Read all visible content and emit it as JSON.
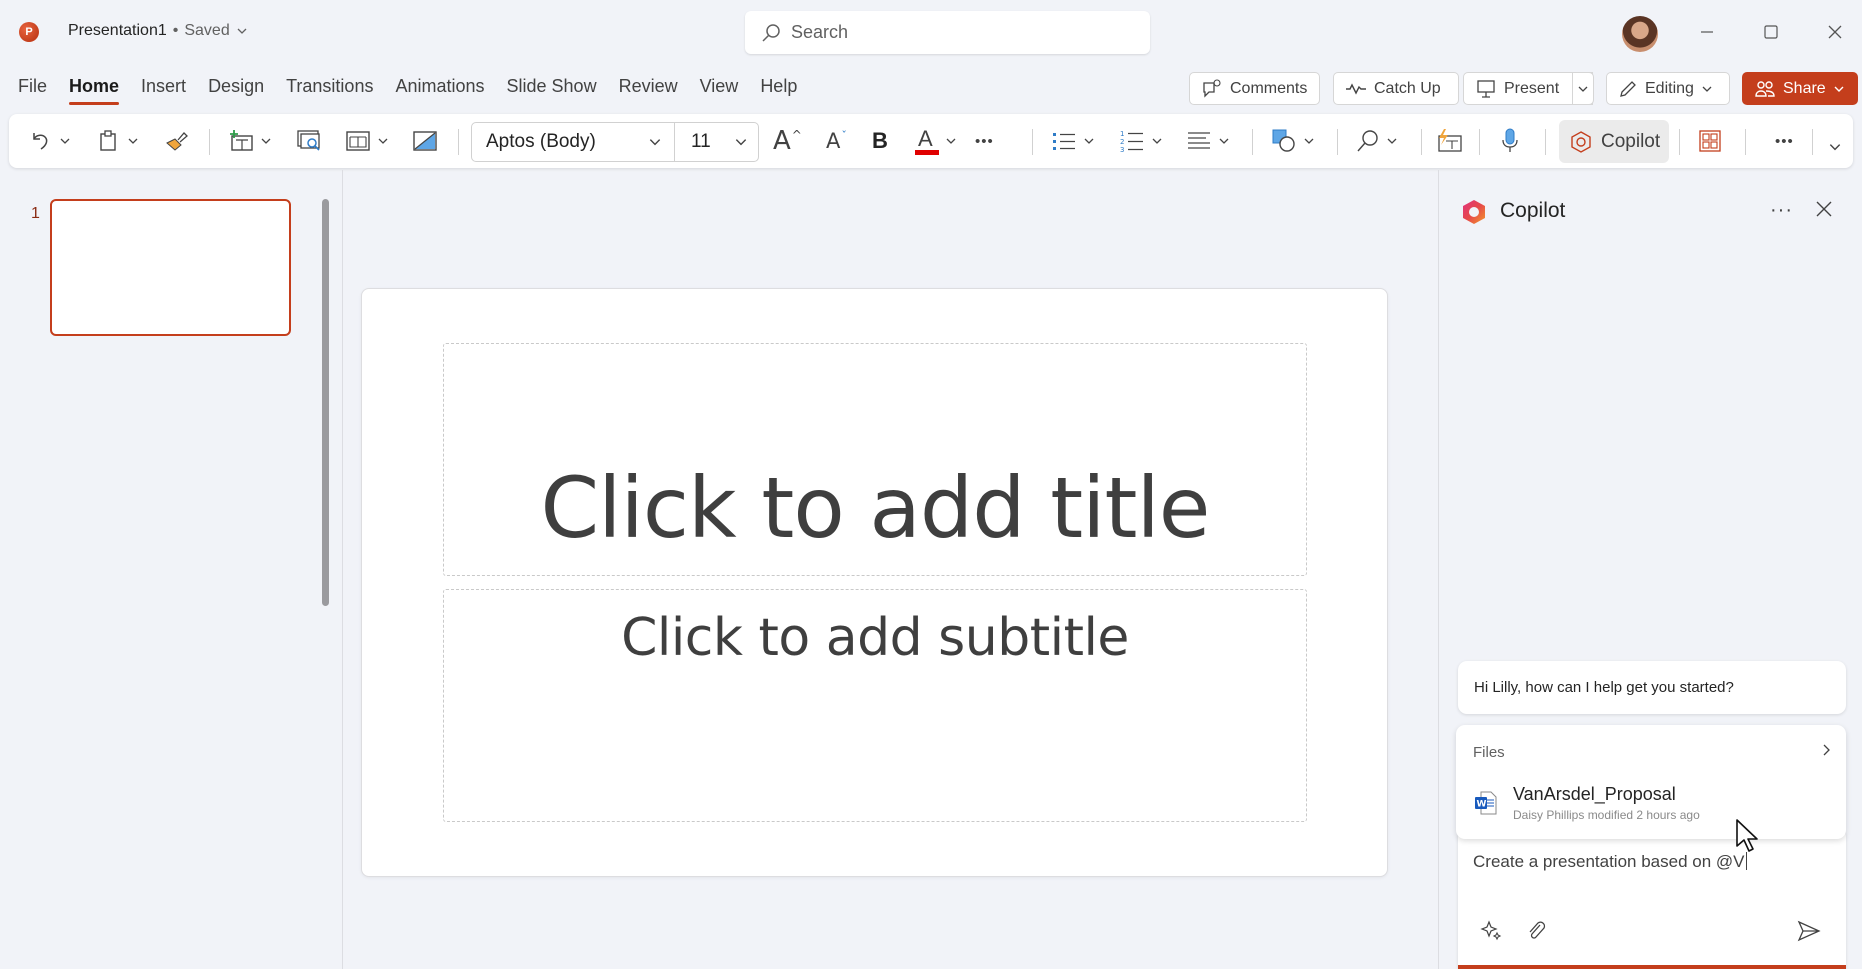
{
  "titlebar": {
    "app_icon_letter": "P",
    "doc_name": "Presentation1",
    "separator": "•",
    "save_status": "Saved",
    "search_placeholder": "Search"
  },
  "menu": {
    "tabs": [
      {
        "label": "File",
        "active": false
      },
      {
        "label": "Home",
        "active": true
      },
      {
        "label": "Insert",
        "active": false
      },
      {
        "label": "Design",
        "active": false
      },
      {
        "label": "Transitions",
        "active": false
      },
      {
        "label": "Animations",
        "active": false
      },
      {
        "label": "Slide Show",
        "active": false
      },
      {
        "label": "Review",
        "active": false
      },
      {
        "label": "View",
        "active": false
      },
      {
        "label": "Help",
        "active": false
      }
    ],
    "actions": {
      "comments": "Comments",
      "catch_up": "Catch Up",
      "present": "Present",
      "editing": "Editing",
      "share": "Share"
    }
  },
  "ribbon": {
    "font_name": "Aptos (Body)",
    "font_size": "11",
    "bold_label": "B",
    "font_color_label": "A",
    "grow_font_label": "A",
    "shrink_font_label": "A",
    "more_label": "•••",
    "copilot_label": "Copilot"
  },
  "slides_pane": {
    "slides": [
      {
        "number": "1",
        "selected": true
      }
    ]
  },
  "slide": {
    "title_placeholder": "Click to add title",
    "subtitle_placeholder": "Click to add subtitle"
  },
  "copilot": {
    "title": "Copilot",
    "more_label": "···",
    "greeting": "Hi Lilly, how can I help get you started?",
    "files_header": "Files",
    "files": [
      {
        "name": "VanArsdel_Proposal",
        "meta": "Daisy Phillips modified 2 hours ago",
        "type": "word"
      }
    ],
    "input_value": "Create a presentation based on @V"
  },
  "colors": {
    "accent": "#c43e1c",
    "word_blue": "#185abd",
    "background": "#f1f3f8"
  }
}
